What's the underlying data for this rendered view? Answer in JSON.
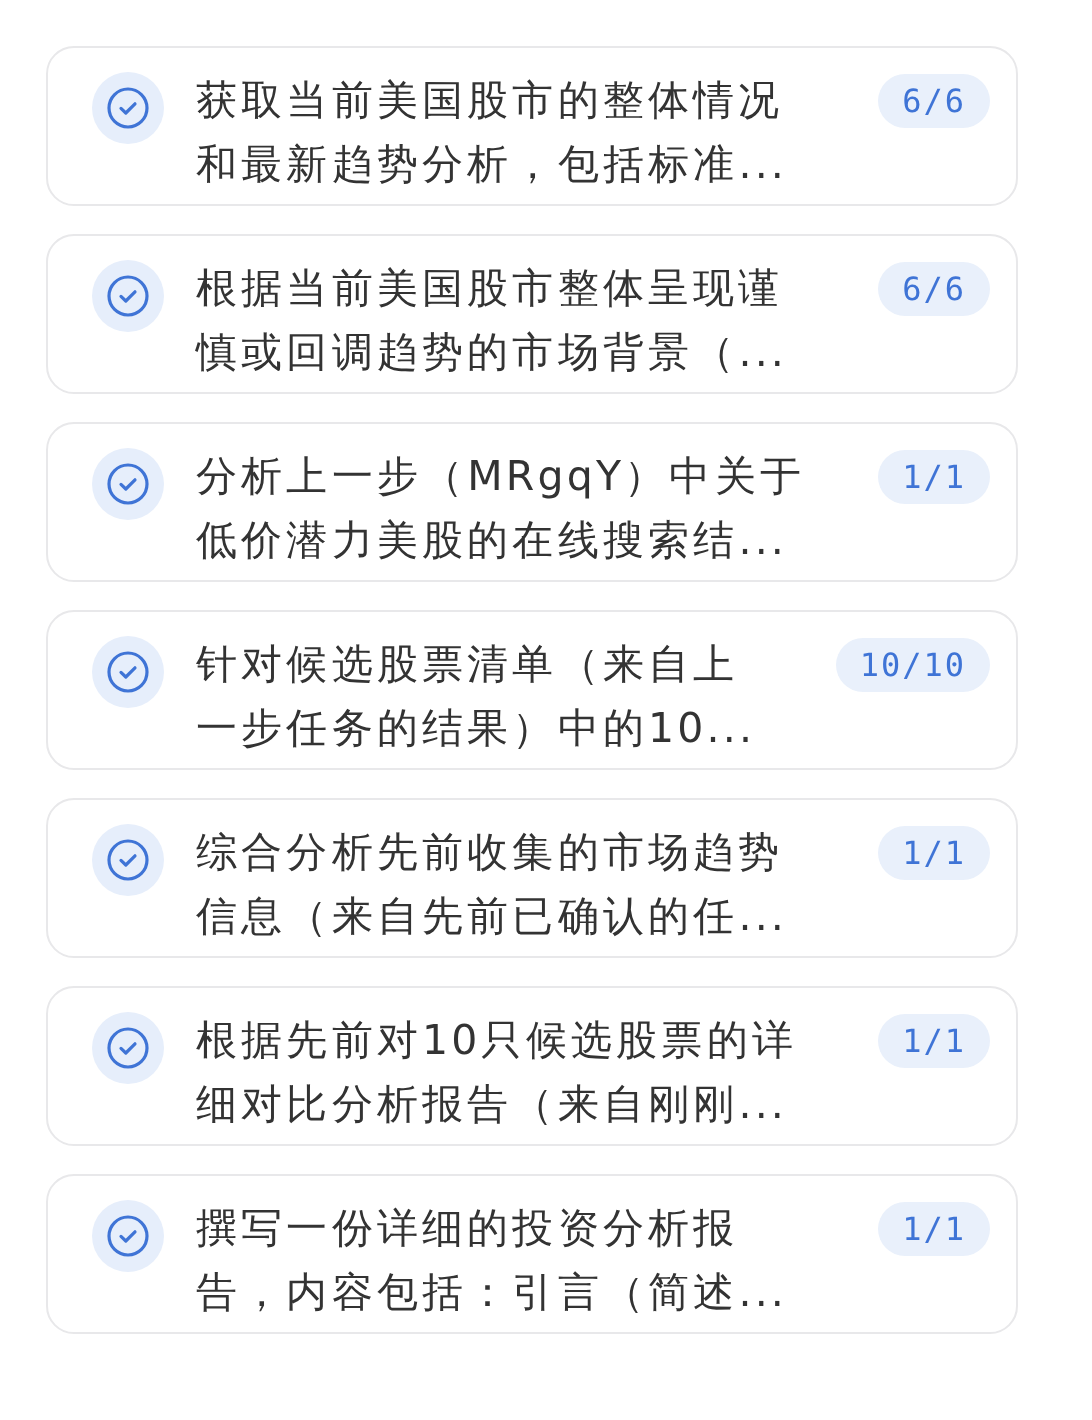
{
  "tasks": [
    {
      "lines": [
        "获取当前美国股市的整体情况",
        "和最新趋势分析，包括标准..."
      ],
      "done": true,
      "count": "6/6"
    },
    {
      "lines": [
        "根据当前美国股市整体呈现谨",
        "慎或回调趋势的市场背景（..."
      ],
      "done": true,
      "count": "6/6"
    },
    {
      "lines": [
        "分析上一步（MRgqY）中关于",
        "低价潜力美股的在线搜索结..."
      ],
      "done": true,
      "count": "1/1"
    },
    {
      "lines": [
        "针对候选股票清单（来自上",
        "一步任务的结果）中的10..."
      ],
      "done": true,
      "count": "10/10"
    },
    {
      "lines": [
        "综合分析先前收集的市场趋势",
        "信息（来自先前已确认的任..."
      ],
      "done": true,
      "count": "1/1"
    },
    {
      "lines": [
        "根据先前对10只候选股票的详",
        "细对比分析报告（来自刚刚..."
      ],
      "done": true,
      "count": "1/1"
    },
    {
      "lines": [
        "撰写一份详细的投资分析报",
        "告，内容包括：引言（简述..."
      ],
      "done": true,
      "count": "1/1"
    }
  ]
}
